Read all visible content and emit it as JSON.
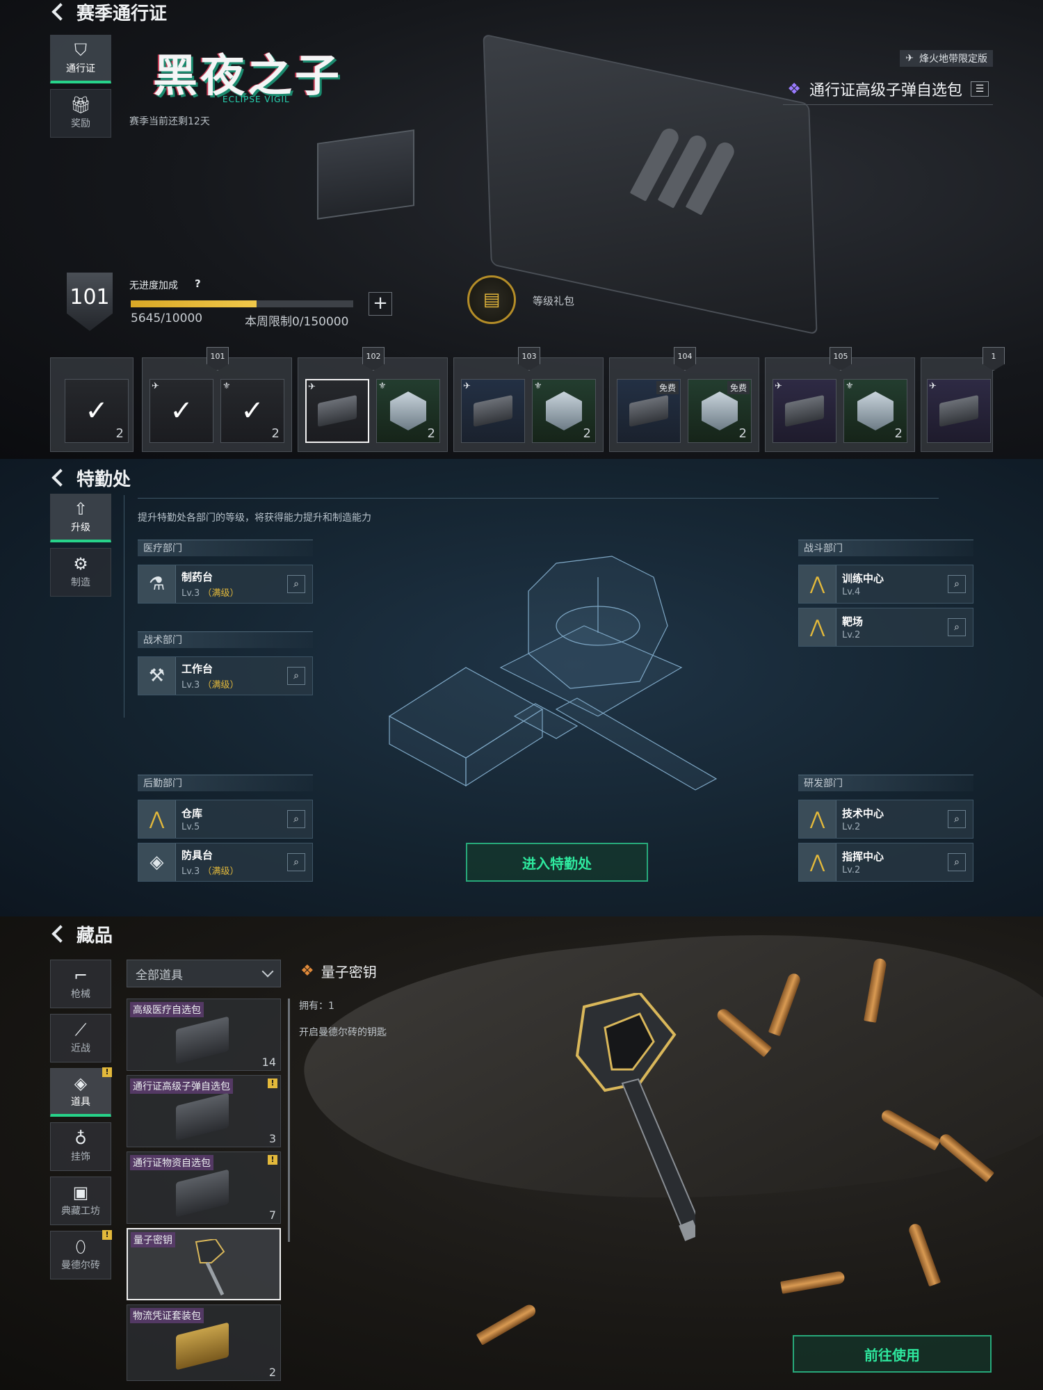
{
  "season_pass": {
    "title": "赛季通行证",
    "tabs": [
      {
        "label": "通行证",
        "icon": "lightning-shield-icon",
        "active": true
      },
      {
        "label": "奖励",
        "icon": "gift-icon",
        "active": false
      }
    ],
    "season_name": "黑夜之子",
    "season_subtitle": "ECLIPSE VIGIL",
    "season_remaining": "赛季当前还剩12天",
    "limited_label": "烽火地带限定版",
    "selected_pack": "通行证高级子弹自选包",
    "level": "101",
    "bonus_label": "无进度加成",
    "help_label": "?",
    "progress": 0.5645,
    "progress_text": "5645/10000",
    "weekly_limit": "本周限制0/150000",
    "gift_label": "等级礼包",
    "rewards": [
      {
        "level": "",
        "free_qty": "2",
        "claimed": true
      },
      {
        "level": "101",
        "premium_qty": "2",
        "claimed": true
      },
      {
        "level": "102",
        "premium_qty": "2"
      },
      {
        "level": "103",
        "premium_qty": "2"
      },
      {
        "level": "104",
        "premium_qty": "2",
        "free_tag": "免费"
      },
      {
        "level": "105",
        "premium_qty": "2"
      }
    ],
    "partial_level": "1"
  },
  "special_ops": {
    "title": "特勤处",
    "tabs": [
      {
        "label": "升级",
        "active": true
      },
      {
        "label": "制造",
        "active": false
      }
    ],
    "description": "提升特勤处各部门的等级，将获得能力提升和制造能力",
    "departments": {
      "medical": {
        "title": "医疗部门",
        "facilities": [
          {
            "name": "制药台",
            "level": "Lv.3",
            "max": "（满级）"
          }
        ]
      },
      "tactical": {
        "title": "战术部门",
        "facilities": [
          {
            "name": "工作台",
            "level": "Lv.3",
            "max": "（满级）"
          }
        ]
      },
      "logistics": {
        "title": "后勤部门",
        "facilities": [
          {
            "name": "仓库",
            "level": "Lv.5"
          },
          {
            "name": "防具台",
            "level": "Lv.3",
            "max": "（满级）"
          }
        ]
      },
      "combat": {
        "title": "战斗部门",
        "facilities": [
          {
            "name": "训练中心",
            "level": "Lv.4"
          },
          {
            "name": "靶场",
            "level": "Lv.2"
          }
        ]
      },
      "research": {
        "title": "研发部门",
        "facilities": [
          {
            "name": "技术中心",
            "level": "Lv.2"
          },
          {
            "name": "指挥中心",
            "level": "Lv.2"
          }
        ]
      }
    },
    "enter_button": "进入特勤处"
  },
  "collection": {
    "title": "藏品",
    "tabs": [
      {
        "label": "枪械",
        "alert": false
      },
      {
        "label": "近战",
        "alert": false
      },
      {
        "label": "道具",
        "alert": true,
        "active": true
      },
      {
        "label": "挂饰",
        "alert": false
      },
      {
        "label": "典藏工坊",
        "alert": false
      },
      {
        "label": "曼德尔砖",
        "alert": true
      }
    ],
    "alert_mark": "!",
    "filter": "全部道具",
    "items": [
      {
        "name": "高级医疗自选包",
        "count": "14",
        "new": false
      },
      {
        "name": "通行证高级子弹自选包",
        "count": "3",
        "new": true
      },
      {
        "name": "通行证物资自选包",
        "count": "7",
        "new": true
      },
      {
        "name": "量子密钥",
        "count": "",
        "new": false,
        "selected": true
      },
      {
        "name": "物流凭证套装包",
        "count": "2",
        "new": false
      }
    ],
    "detail": {
      "name": "量子密钥",
      "owned": "拥有：1",
      "description": "开启曼德尔砖的钥匙"
    },
    "use_button": "前往使用"
  },
  "colors": {
    "accent_green": "#27d38a",
    "gold": "#e3b93b",
    "max_level": "#e3b93b"
  }
}
